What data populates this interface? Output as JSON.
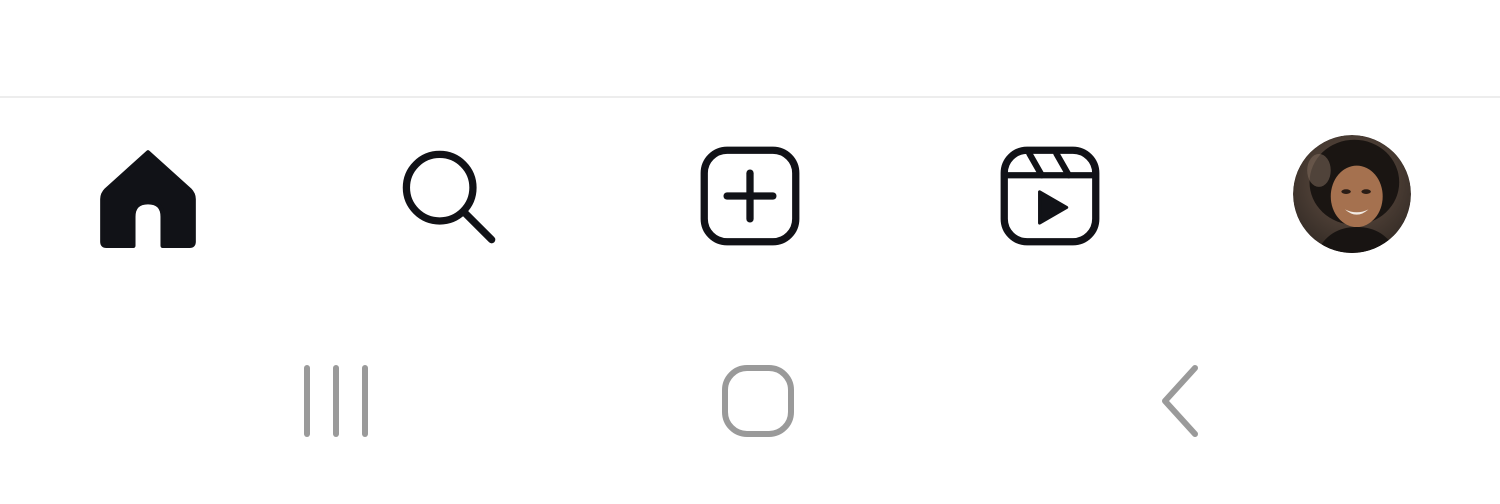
{
  "colors": {
    "background": "#ffffff",
    "divider": "#ededed",
    "tab_icon": "#111217",
    "system_nav_icon": "#9a9a9a"
  },
  "tab_bar": {
    "items": [
      {
        "id": "home",
        "icon": "home-icon",
        "active": true
      },
      {
        "id": "search",
        "icon": "search-icon",
        "active": false
      },
      {
        "id": "create",
        "icon": "plus-square-icon",
        "active": false
      },
      {
        "id": "reels",
        "icon": "reels-icon",
        "active": false
      },
      {
        "id": "profile",
        "icon": "profile-avatar",
        "active": false
      }
    ]
  },
  "system_nav": {
    "items": [
      {
        "id": "recents",
        "icon": "recents-icon"
      },
      {
        "id": "home",
        "icon": "home-outline-icon"
      },
      {
        "id": "back",
        "icon": "back-chevron-icon"
      }
    ]
  }
}
